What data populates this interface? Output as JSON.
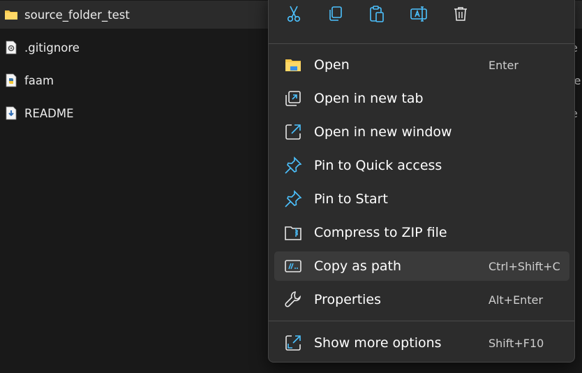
{
  "files": [
    {
      "name": "source_folder_test",
      "icon": "folder-icon",
      "selected": true
    },
    {
      "name": ".gitignore",
      "icon": "gear-file-icon"
    },
    {
      "name": "faam",
      "icon": "python-file-icon"
    },
    {
      "name": "README",
      "icon": "markdown-file-icon"
    }
  ],
  "edge_fragments": [
    "e",
    "le",
    "e"
  ],
  "toolbar": [
    {
      "name": "cut",
      "icon": "scissors-icon"
    },
    {
      "name": "copy",
      "icon": "copy-icon"
    },
    {
      "name": "paste",
      "icon": "clipboard-icon"
    },
    {
      "name": "rename",
      "icon": "rename-icon"
    },
    {
      "name": "delete",
      "icon": "trash-icon"
    }
  ],
  "menu": {
    "items": [
      {
        "label": "Open",
        "shortcut": "Enter",
        "icon": "folder-icon"
      },
      {
        "label": "Open in new tab",
        "shortcut": "",
        "icon": "new-tab-icon"
      },
      {
        "label": "Open in new window",
        "shortcut": "",
        "icon": "new-window-icon"
      },
      {
        "label": "Pin to Quick access",
        "shortcut": "",
        "icon": "pin-icon"
      },
      {
        "label": "Pin to Start",
        "shortcut": "",
        "icon": "pin-icon"
      },
      {
        "label": "Compress to ZIP file",
        "shortcut": "",
        "icon": "zip-folder-icon"
      },
      {
        "label": "Copy as path",
        "shortcut": "Ctrl+Shift+C",
        "icon": "copy-path-icon",
        "hovered": true
      },
      {
        "label": "Properties",
        "shortcut": "Alt+Enter",
        "icon": "wrench-icon"
      }
    ],
    "more": {
      "label": "Show more options",
      "shortcut": "Shift+F10",
      "icon": "more-options-icon"
    }
  },
  "colors": {
    "accent": "#4cc2ff",
    "folder": "#f8c84a",
    "background": "#191919",
    "menu": "#2c2c2c"
  }
}
